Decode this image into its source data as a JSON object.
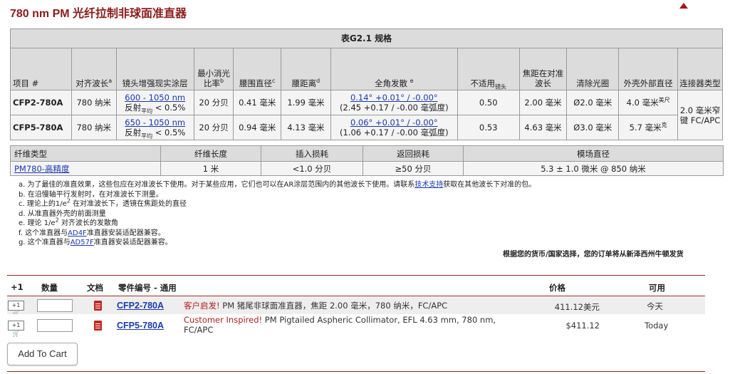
{
  "title": "780 nm PM 光纤拉制非球面准直器",
  "spec_table": {
    "caption": "表G2.1 规格",
    "headers": {
      "item": "项目 #",
      "align_wl": "对齐波长",
      "align_wl_sup": "a",
      "coating": "镜头增强现实涂层",
      "extinction": "最小消光比率",
      "extinction_sup": "b",
      "waist_dia": "腰围直径",
      "waist_dia_sup": "c",
      "waist_dist": "腰距离",
      "waist_dist_sup": "d",
      "divergence": "全角发散",
      "divergence_sup": "e",
      "na_main": "不适用",
      "na_sub": "镜头",
      "focal": "焦距在对准波长",
      "clear": "清除光圈",
      "housing": "外壳外部直径",
      "connector": "连接器类型"
    },
    "rows": [
      {
        "item": "CFP2-780A",
        "align_wl": "780 纳米",
        "coating_link": "600 - 1050 nm",
        "coating_text_a": "反射",
        "coating_sub": "平均",
        "coating_text_b": "< 0.5%",
        "extinction": "20 分贝",
        "waist_dia": "0.41 毫米",
        "waist_dist": "1.99 毫米",
        "div_link": "0.14° +0.01° / -0.00°",
        "div_rad": "(2.45 +0.17 / -0.00 毫弧度)",
        "na": "0.50",
        "focal": "2.00 毫米",
        "clear": "Ø2.0 毫米",
        "housing": "4.0 毫米",
        "housing_sup": "美尺"
      },
      {
        "item": "CFP5-780A",
        "align_wl": "780 纳米",
        "coating_link": "650 - 1050 nm",
        "coating_text_a": "反射",
        "coating_sub": "平均",
        "coating_text_b": "< 0.5%",
        "extinction": "20 分贝",
        "waist_dia": "0.94 毫米",
        "waist_dist": "4.13 毫米",
        "div_link": "0.06° +0.01° / -0.00°",
        "div_rad": "(1.06 +0.17 / -0.00 毫弧度)",
        "na": "0.53",
        "focal": "4.63 毫米",
        "clear": "Ø3.0 毫米",
        "housing": "5.7 毫米",
        "housing_sup": "克"
      }
    ],
    "connector": "2.0 毫米窄键 FC/APC"
  },
  "fiber_table": {
    "headers": [
      "纤维类型",
      "纤维长度",
      "插入损耗",
      "返回损耗",
      "模场直径"
    ],
    "row": {
      "type": "PM780-高精度",
      "length": "1 米",
      "insertion": "<1.0 分贝",
      "return": "≥50 分贝",
      "mfd": "5.3 ± 1.0 微米 @ 850 纳米"
    }
  },
  "notes": {
    "a_pre": "a. 为了最佳的准直效果，这些包应在对准波长下使用。对于某些应用，它们也可以在AR涂层范围内的其他波长下使用。请联系",
    "a_link": "技术支持",
    "a_post": "获取在其他波长下对准的包。",
    "b": "b. 在沿慢轴平行发射时，在对准波长下测量。",
    "c_pre": "c. 理论上的1/e",
    "c_sup": "2",
    "c_post": " 在对准波长下，透镜在焦距处的直径",
    "d": "d. 从准直器外壳的前面测量",
    "e_pre": "e. 理论 1/e",
    "e_sup": "2",
    "e_post": " 对齐波长的发散角",
    "f_pre": "f. 这个准直器与",
    "f_link": "AD4F",
    "f_post": "准直器安装适配器兼容。",
    "g_pre": "g. 这个准直器与",
    "g_link": "AD57F",
    "g_post": "准直器安装适配器兼容。"
  },
  "shipping_note": "根据您的货币/国家选择，您的订单将从新泽西州牛顿发货",
  "cart": {
    "headers": {
      "plus": "+1",
      "qty": "数量",
      "doc": "文档",
      "part": "零件编号 - 通用",
      "price": "价格",
      "avail": "可用"
    },
    "items": [
      {
        "icon_text": "+1🛒",
        "part": "CFP2-780A",
        "inspired": "客户启发!",
        "desc": " PM 猪尾非球面准直器，焦距 2.00 毫米，780 纳米，FC/APC",
        "price": "411.12美元",
        "avail": "今天"
      },
      {
        "icon_text": "+1🛒",
        "part": "CFP5-780A",
        "inspired": "Customer Inspired!",
        "desc": " PM Pigtailed Aspheric Collimator, EFL 4.63 mm, 780 nm, FC/APC",
        "price": "$411.12",
        "avail": "Today"
      }
    ],
    "add_button": "Add To Cart"
  },
  "colors": {
    "title": "#8b1b1b",
    "link": "#1a39b0",
    "inspired": "#b32020",
    "rule": "#9b2222"
  }
}
